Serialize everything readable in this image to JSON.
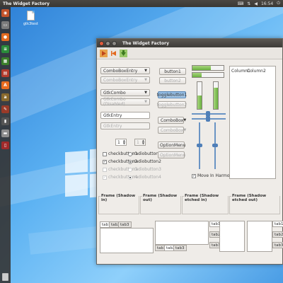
{
  "top_panel": {
    "app_title": "The Widget Factory",
    "time": "16:54"
  },
  "desktop": {
    "file_label": "gtk3test"
  },
  "window": {
    "title": "The Widget Factory"
  },
  "left_column": {
    "combo_entry": "ComboBoxEntry",
    "combo_entry_disabled": "ComboBoxEntry",
    "gtk_combo": "GtkCombo",
    "gtk_combo_disabled": "GtkCombo (Disabled)",
    "gtk_entry": "GtkEntry",
    "gtk_entry_disabled": "GtkEntry",
    "spin1_value": "1",
    "spin2_value": "1",
    "checkbutton1": "checkbutton1",
    "checkbutton2": "checkbutton2",
    "checkbutton3": "checkbutton3",
    "checkbutton4": "checkbutton4",
    "radiobutton1": "radiobutton1",
    "radiobutton2": "radiobutton2",
    "radiobutton3": "radiobutton3",
    "radiobutton4": "radiobutton4"
  },
  "middle_column": {
    "button1": "button1",
    "button2": "button2",
    "togglebutton1": "togglebutton1",
    "togglebutton2": "togglebutton2",
    "combobox": "ComboBox",
    "combobox_disabled": "ComboBox",
    "optionmenu": "OptionMenu",
    "optionmenu_disabled": "OptionMenu"
  },
  "right_column": {
    "move_in_harmony": "Move In Harmony",
    "progress_h1": 0.6,
    "progress_h2": 0.3,
    "progress_v1": 0.5,
    "progress_v2": 0.8
  },
  "treeview": {
    "columns": [
      "Column1",
      "Column2"
    ]
  },
  "frames": [
    "Frame (Shadow in)",
    "Frame (Shadow out)",
    "Frame (Shadow etched in)",
    "Frame (Shadow etched out)"
  ],
  "tabs": {
    "top": [
      "tab1",
      "tab2",
      "tab3"
    ],
    "bottom": [
      "tab1",
      "tab2",
      "tab3"
    ],
    "left": [
      "tab1",
      "tab2",
      "tab3"
    ],
    "right": [
      "tab1",
      "tab2",
      "tab3"
    ]
  },
  "colors": {
    "panel": "#3a3834",
    "progress_green": "#6ab23f",
    "slider_blue": "#4f7fb8"
  }
}
